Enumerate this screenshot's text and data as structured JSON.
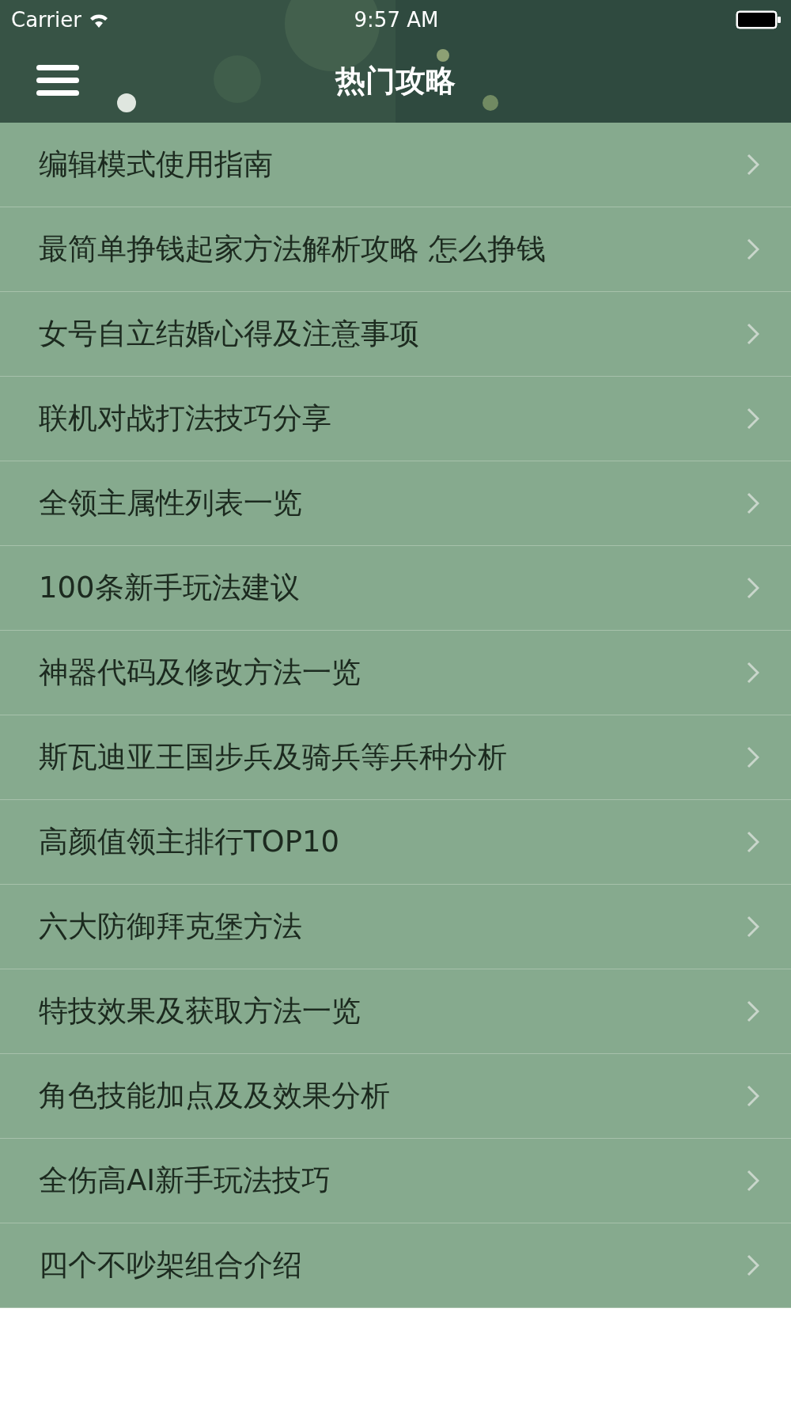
{
  "status_bar": {
    "carrier": "Carrier",
    "time": "9:57 AM"
  },
  "nav_bar": {
    "title": "热门攻略"
  },
  "list": {
    "items": [
      {
        "title": "编辑模式使用指南"
      },
      {
        "title": "最简单挣钱起家方法解析攻略 怎么挣钱"
      },
      {
        "title": "女号自立结婚心得及注意事项"
      },
      {
        "title": "联机对战打法技巧分享"
      },
      {
        "title": "全领主属性列表一览"
      },
      {
        "title": "100条新手玩法建议"
      },
      {
        "title": "神器代码及修改方法一览"
      },
      {
        "title": "斯瓦迪亚王国步兵及骑兵等兵种分析"
      },
      {
        "title": "高颜值领主排行TOP10"
      },
      {
        "title": "六大防御拜克堡方法"
      },
      {
        "title": "特技效果及获取方法一览"
      },
      {
        "title": "角色技能加点及及效果分析"
      },
      {
        "title": "全伤高AI新手玩法技巧"
      },
      {
        "title": "四个不吵架组合介绍"
      }
    ]
  }
}
